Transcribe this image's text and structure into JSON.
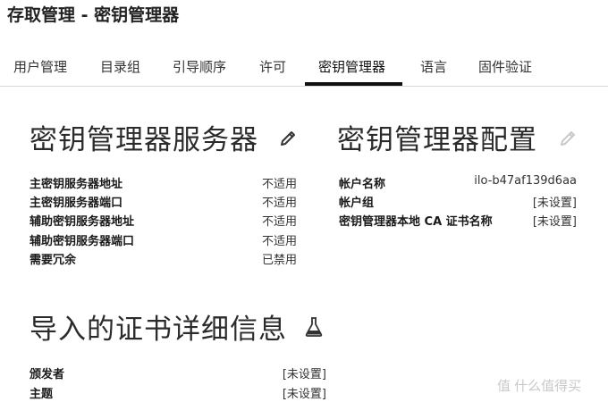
{
  "page_title": "存取管理 - 密钥管理器",
  "tabs": [
    {
      "label": "用户管理"
    },
    {
      "label": "目录组"
    },
    {
      "label": "引导顺序"
    },
    {
      "label": "许可"
    },
    {
      "label": "密钥管理器",
      "active": true
    },
    {
      "label": "语言"
    },
    {
      "label": "固件验证"
    }
  ],
  "server_section": {
    "title": "密钥管理器服务器",
    "edit_icon": "pencil-icon",
    "fields": [
      {
        "label": "主密钥服务器地址",
        "value": "不适用"
      },
      {
        "label": "主密钥服务器端口",
        "value": "不适用"
      },
      {
        "label": "辅助密钥服务器地址",
        "value": "不适用"
      },
      {
        "label": "辅助密钥服务器端口",
        "value": "不适用"
      },
      {
        "label": "需要冗余",
        "value": "已禁用"
      }
    ]
  },
  "config_section": {
    "title": "密钥管理器配置",
    "edit_icon": "pencil-icon",
    "fields": [
      {
        "label": "帐户名称",
        "value": "ilo-b47af139d6aa"
      },
      {
        "label": "帐户组",
        "value": "[未设置]"
      },
      {
        "label": "密钥管理器本地 CA 证书名称",
        "value": "[未设置]"
      }
    ]
  },
  "cert_section": {
    "title": "导入的证书详细信息",
    "icon": "flask-icon",
    "fields": [
      {
        "label": "颁发者",
        "value": "[未设置]"
      },
      {
        "label": "主题",
        "value": "[未设置]"
      }
    ]
  },
  "watermark": "值 什么值得买",
  "colors": {
    "accent": "#111111",
    "disabled_icon": "#c8c8c8"
  }
}
